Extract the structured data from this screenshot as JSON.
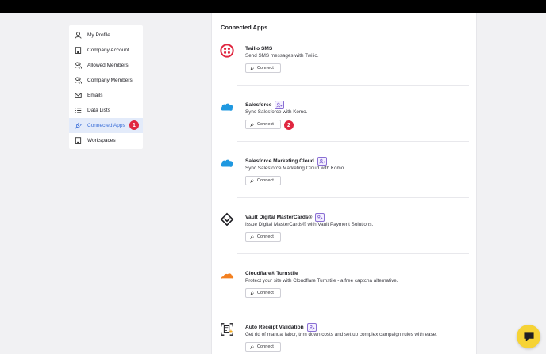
{
  "sidebar": {
    "items": [
      {
        "label": "My Profile",
        "icon": "user-icon"
      },
      {
        "label": "Company Account",
        "icon": "building-icon"
      },
      {
        "label": "Allowed Members",
        "icon": "users-icon"
      },
      {
        "label": "Company Members",
        "icon": "users-icon"
      },
      {
        "label": "Emails",
        "icon": "mail-icon"
      },
      {
        "label": "Data Lists",
        "icon": "list-icon"
      },
      {
        "label": "Connected Apps",
        "icon": "plug-icon",
        "active": true,
        "badge": "1"
      },
      {
        "label": "Workspaces",
        "icon": "building-icon"
      }
    ]
  },
  "main": {
    "title": "Connected Apps",
    "connect_badge": "2",
    "apps": [
      {
        "name": "Twilio SMS",
        "description": "Send SMS messages with Twilio.",
        "button": "Connect",
        "logo": "twilio-logo-icon",
        "ai_tag": false
      },
      {
        "name": "Salesforce",
        "description": "Sync Salesforce with Komo.",
        "button": "Connect",
        "logo": "salesforce-cloud-icon",
        "ai_tag": true
      },
      {
        "name": "Salesforce Marketing Cloud",
        "description": "Sync Salesforce Marketing Cloud with Komo.",
        "button": "Connect",
        "logo": "salesforce-cloud-icon",
        "ai_tag": true
      },
      {
        "name": "Vault Digital MasterCards®",
        "description": "Issue Digital MasterCards® with Vault Payment Solutions.",
        "button": "Connect",
        "logo": "vault-diamond-icon",
        "ai_tag": true
      },
      {
        "name": "Cloudflare® Turnstile",
        "description": "Protect your site with Cloudflare Turnstile - a free captcha alternative.",
        "button": "Connect",
        "logo": "cloudflare-cloud-icon",
        "ai_tag": false
      },
      {
        "name": "Auto Receipt Validation",
        "description": "Get rid of manual labor, trim down costs and set up complex campaign rules with ease.",
        "button": "Connect",
        "logo": "receipt-scan-icon",
        "ai_tag": true
      }
    ]
  },
  "colors": {
    "accent": "#3b6fd8",
    "badge": "#e0263f",
    "twilio": "#e0263f",
    "salesforce": "#1f98e0",
    "cloudflare": "#f38020",
    "chat": "#f6d335"
  }
}
